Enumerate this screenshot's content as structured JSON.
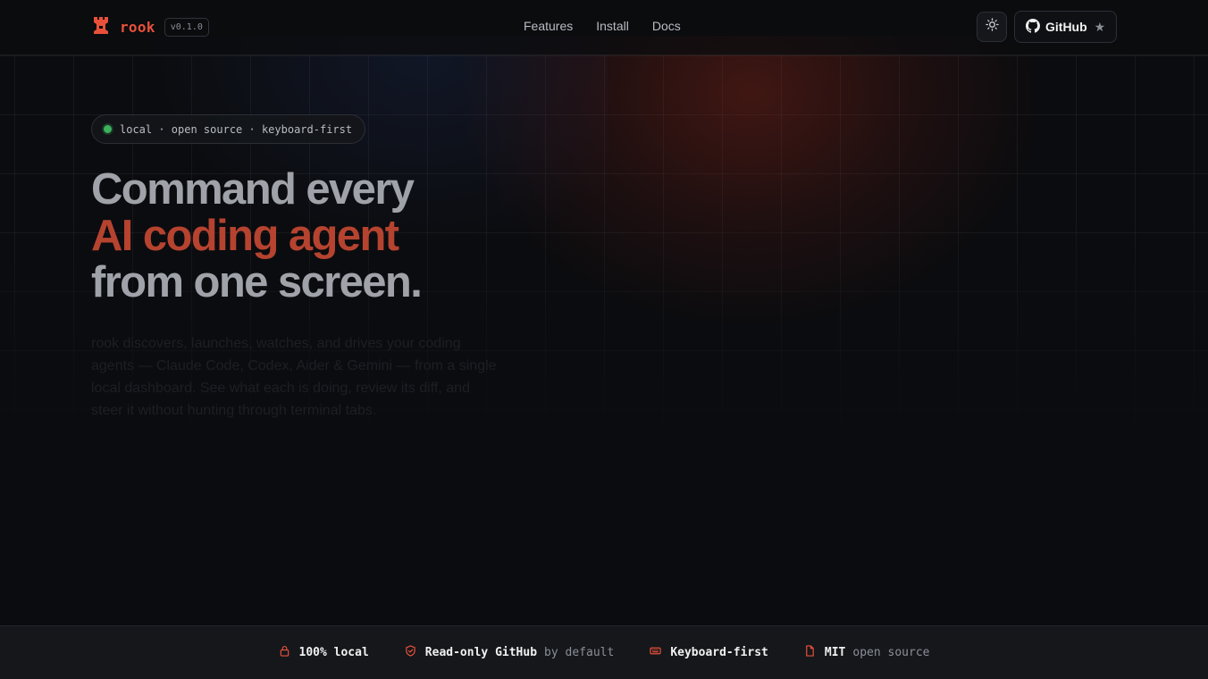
{
  "brand": {
    "name": "rook",
    "version": "v0.1.0",
    "accent": "#e8503a"
  },
  "nav": {
    "items": [
      "Features",
      "Install",
      "Docs"
    ]
  },
  "header": {
    "github_label": "GitHub",
    "star_glyph": "★"
  },
  "hero": {
    "badge": "local · open source · keyboard-first",
    "line1": "Command every",
    "line2": "AI coding agent",
    "line3": "from one screen.",
    "lead": "rook discovers, launches, watches, and drives your coding agents — Claude Code, Codex, Aider & Gemini — from a single local dashboard. See what each is doing, review its diff, and steer it without hunting through terminal tabs."
  },
  "features": [
    {
      "icon": "lock-icon",
      "strong": "100% local",
      "muted": ""
    },
    {
      "icon": "shield-icon",
      "strong": "Read-only GitHub",
      "muted": "by default"
    },
    {
      "icon": "keyboard-icon",
      "strong": "Keyboard-first",
      "muted": ""
    },
    {
      "icon": "file-icon",
      "strong": "MIT",
      "muted": "open source"
    }
  ]
}
